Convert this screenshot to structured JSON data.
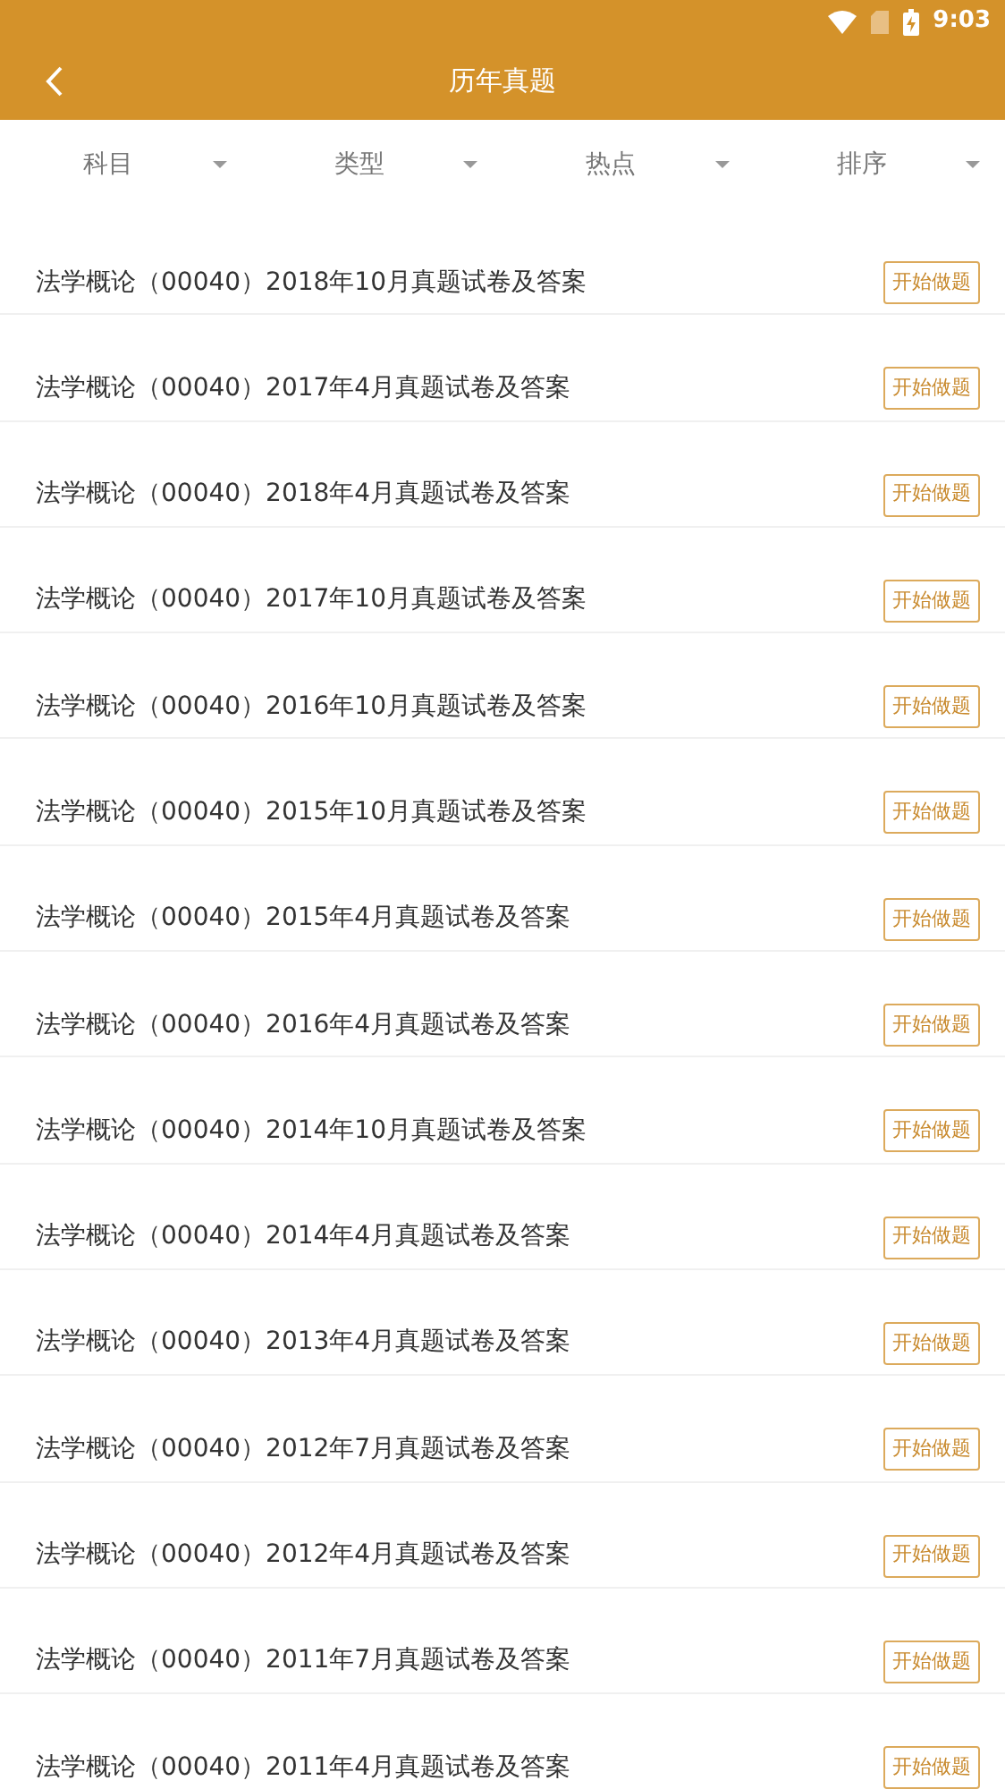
{
  "status_bar": {
    "time": "9:03"
  },
  "header": {
    "title": "历年真题"
  },
  "filters": [
    {
      "label": "科目"
    },
    {
      "label": "类型"
    },
    {
      "label": "热点"
    },
    {
      "label": "排序"
    }
  ],
  "papers": [
    {
      "title": "法学概论（00040）2018年10月真题试卷及答案",
      "action": "开始做题"
    },
    {
      "title": "法学概论（00040）2017年4月真题试卷及答案",
      "action": "开始做题"
    },
    {
      "title": "法学概论（00040）2018年4月真题试卷及答案",
      "action": "开始做题"
    },
    {
      "title": "法学概论（00040）2017年10月真题试卷及答案",
      "action": "开始做题"
    },
    {
      "title": "法学概论（00040）2016年10月真题试卷及答案",
      "action": "开始做题"
    },
    {
      "title": "法学概论（00040）2015年10月真题试卷及答案",
      "action": "开始做题"
    },
    {
      "title": "法学概论（00040）2015年4月真题试卷及答案",
      "action": "开始做题"
    },
    {
      "title": "法学概论（00040）2016年4月真题试卷及答案",
      "action": "开始做题"
    },
    {
      "title": "法学概论（00040）2014年10月真题试卷及答案",
      "action": "开始做题"
    },
    {
      "title": "法学概论（00040）2014年4月真题试卷及答案",
      "action": "开始做题"
    },
    {
      "title": "法学概论（00040）2013年4月真题试卷及答案",
      "action": "开始做题"
    },
    {
      "title": "法学概论（00040）2012年7月真题试卷及答案",
      "action": "开始做题"
    },
    {
      "title": "法学概论（00040）2012年4月真题试卷及答案",
      "action": "开始做题"
    },
    {
      "title": "法学概论（00040）2011年7月真题试卷及答案",
      "action": "开始做题"
    },
    {
      "title": "法学概论（00040）2011年4月真题试卷及答案",
      "action": "开始做题"
    }
  ]
}
